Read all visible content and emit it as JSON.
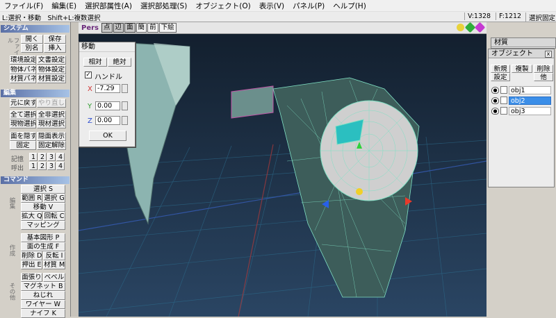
{
  "menu": [
    "ファイル(F)",
    "編集(E)",
    "選択部属性(A)",
    "選択部処理(S)",
    "オブジェクト(O)",
    "表示(V)",
    "パネル(P)",
    "ヘルプ(H)"
  ],
  "status": {
    "hint": "L:選択・移動　Shift+L:複数選択",
    "vertices": "V:1328",
    "faces": "F:1212",
    "lock": "選択固定"
  },
  "left": {
    "system": {
      "title": "システム",
      "side": "ファイル",
      "open": "開く",
      "save": "保存",
      "saveas": "別名",
      "insert": "挿入",
      "env": "環境設定",
      "doc": "文書設定",
      "objpanel": "物体パネル",
      "objsettings": "物体設定",
      "matpanel": "材質パネル",
      "matsettings": "材質設定"
    },
    "edit": {
      "title": "編集",
      "undo": "元に戻す",
      "redo": "やり直し",
      "selall": "全て選択",
      "deselall": "全非選択",
      "selcur": "現物選択",
      "selmat": "現材選択",
      "hideface": "面を隠す",
      "showhidden": "隠面表示",
      "fix": "固定",
      "unfix": "固定解除",
      "mem": "記憶",
      "recall": "呼出",
      "n1": "1",
      "n2": "2",
      "n3": "3",
      "n4": "4"
    },
    "command": {
      "title": "コマンド",
      "edit_side": "編集",
      "select": "選択 S",
      "range": "範囲 R",
      "sel_g": "選択 G",
      "move": "移動 V",
      "scale": "拡大 Q",
      "rotate": "回転 C",
      "mapping": "マッピング",
      "create_side": "作成",
      "basic": "基本図形 P",
      "facegen": "面の生成 F",
      "del": "削除 D",
      "flip": "反転 I",
      "extrude": "押出 E",
      "mat": "材質 M",
      "other_side": "その他",
      "facepaste": "面張り",
      "bevel": "ベベル",
      "magnet": "マグネット B",
      "twist": "ねじれ",
      "wire": "ワイヤー W",
      "knife": "ナイフ K"
    }
  },
  "viewtool": {
    "pers": "Pers",
    "point": "点",
    "edge": "辺",
    "face": "面",
    "simple": "簡",
    "front": "前",
    "lower": "下絵"
  },
  "dialog": {
    "title": "移動",
    "relative": "相対",
    "absolute": "絶対",
    "handle": "ハンドル",
    "xlabel": "X",
    "ylabel": "Y",
    "zlabel": "Z",
    "x": "-7.29",
    "y": "0.00",
    "z": "0.00",
    "ok": "OK"
  },
  "right": {
    "material_title": "材質",
    "object_title": "オブジェクト",
    "close": "x",
    "new": "新規",
    "dup": "複製",
    "del": "削除",
    "settings": "設定",
    "other": "他",
    "objects": [
      {
        "name": "obj1"
      },
      {
        "name": "obj2",
        "selected": true
      },
      {
        "name": "obj3"
      }
    ]
  },
  "colors": {
    "viewport_bg": "#1d3247",
    "mesh": "#7fe0c4",
    "selected": "#3b8ee8",
    "grid": "#2c6a8a"
  }
}
